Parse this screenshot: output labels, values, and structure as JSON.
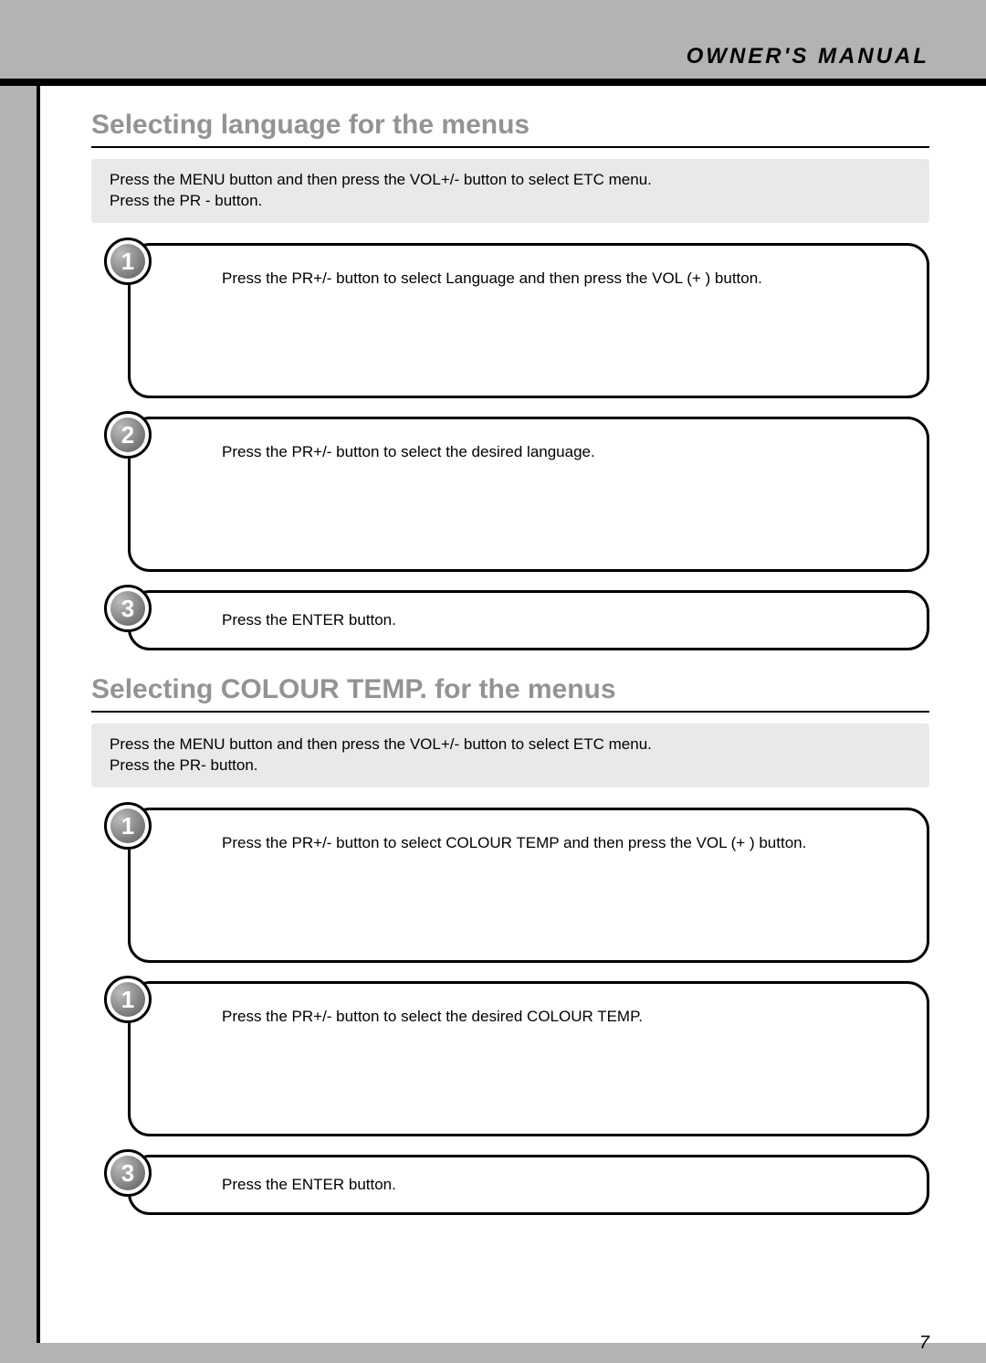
{
  "header": {
    "label": "OWNER'S MANUAL"
  },
  "page_number": "7",
  "sections": [
    {
      "title": "Selecting language for the menus",
      "intro_line1": "Press the MENU button and then press the VOL+/- button to select ETC menu.",
      "intro_line2": "Press the PR - button.",
      "steps": [
        {
          "num": "1",
          "text": "Press the PR+/- button to select Language and then press the VOL (+ ) button.",
          "size": "tall"
        },
        {
          "num": "2",
          "text": "Press the PR+/- button to select the desired language.",
          "size": "tall"
        },
        {
          "num": "3",
          "text": "Press the ENTER button.",
          "size": "short"
        }
      ]
    },
    {
      "title": "Selecting COLOUR TEMP. for the menus",
      "intro_line1": "Press the MENU button and then press the VOL+/- button to select ETC menu.",
      "intro_line2": "Press the PR- button.",
      "steps": [
        {
          "num": "1",
          "text": "Press the PR+/- button to select COLOUR TEMP and then press the VOL (+ ) button.",
          "size": "tall"
        },
        {
          "num": "1",
          "text": "Press the PR+/- button to select the desired COLOUR TEMP.",
          "size": "tall"
        },
        {
          "num": "3",
          "text": "Press the ENTER button.",
          "size": "short"
        }
      ]
    }
  ]
}
